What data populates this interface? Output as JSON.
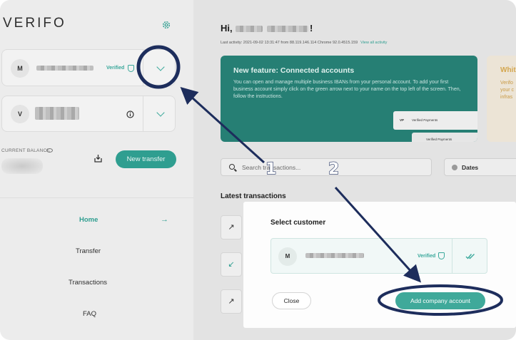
{
  "colors": {
    "accent": "#2f9e90",
    "annotation": "#1d2d5c",
    "banner_bg": "#267f74",
    "banner2_title": "#d4a64d"
  },
  "sidebar": {
    "logo": "VERIFO",
    "settings_icon": "gear-icon",
    "accounts": [
      {
        "initial": "M",
        "verified_label": "Verified"
      },
      {
        "initial": "V"
      }
    ],
    "balance_label": "CURRENT BALANCE",
    "new_transfer_label": "New transfer",
    "nav": [
      {
        "label": "Home",
        "active": true
      },
      {
        "label": "Transfer",
        "active": false
      },
      {
        "label": "Transactions",
        "active": false
      },
      {
        "label": "FAQ",
        "active": false
      }
    ],
    "nav_arrow": "→"
  },
  "main": {
    "greeting": "Hi,",
    "greeting_end": "!",
    "last_activity": "Last activity: 2021-09-02 13:31:47 from 88.119.146.114 Chrome 92.0.4515.159",
    "view_all_activity": "View all activity",
    "banner": {
      "title": "New feature: Connected accounts",
      "text": "You can open and manage multiple business IBANs from your personal account. To add your first business account simply click on the green arrow next to your name on the top left of the screen. Then, follow the instructions.",
      "mini_card_initial": "VP",
      "mini_card_label": "Verified Payments"
    },
    "banner2": {
      "title": "Whit",
      "lines": [
        "Verifo",
        "your c",
        "infras"
      ]
    },
    "search_placeholder": "Search transactions...",
    "dates_label": "Dates",
    "latest_title": "Latest transactions",
    "tx_icons": [
      "↗",
      "↙",
      "↗"
    ]
  },
  "modal": {
    "title": "Select customer",
    "customer_initial": "M",
    "verified_label": "Verified",
    "close_label": "Close",
    "add_label": "Add company account"
  },
  "annotations": {
    "step1": "1",
    "step2": "2"
  }
}
